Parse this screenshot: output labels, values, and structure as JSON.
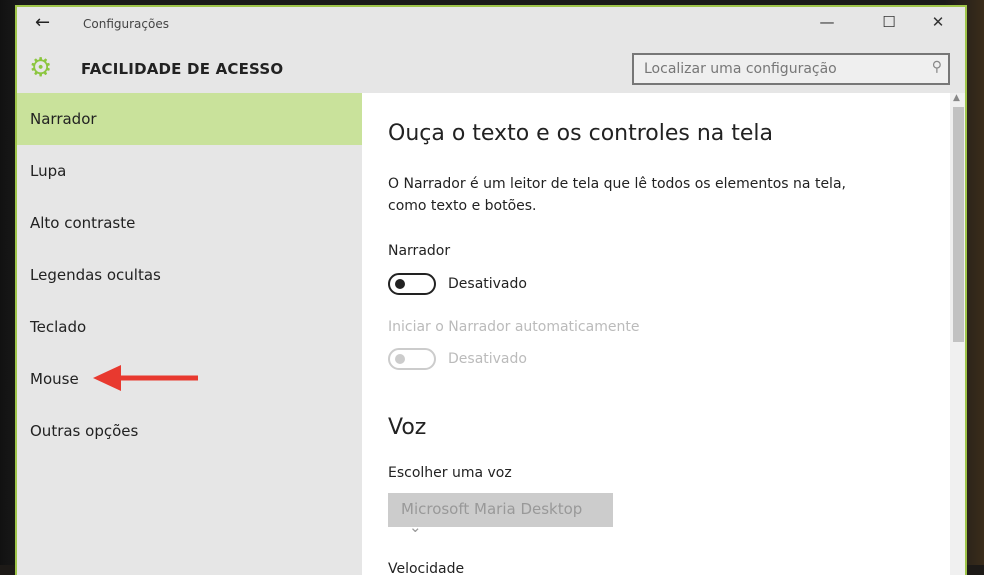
{
  "window": {
    "title": "Configurações",
    "section": "FACILIDADE DE ACESSO",
    "search_placeholder": "Localizar uma configuração"
  },
  "sidebar": {
    "items": [
      {
        "label": "Narrador",
        "selected": true
      },
      {
        "label": "Lupa"
      },
      {
        "label": "Alto contraste"
      },
      {
        "label": "Legendas ocultas"
      },
      {
        "label": "Teclado"
      },
      {
        "label": "Mouse"
      },
      {
        "label": "Outras opções"
      }
    ]
  },
  "main": {
    "heading": "Ouça o texto e os controles na tela",
    "description": "O Narrador é um leitor de tela que lê todos os elementos na tela, como texto e botões.",
    "narrator_label": "Narrador",
    "narrator_state": "Desativado",
    "auto_label": "Iniciar o Narrador automaticamente",
    "auto_state": "Desativado",
    "voice_heading": "Voz",
    "voice_label": "Escolher uma voz",
    "voice_value": "Microsoft Maria Desktop",
    "speed_label": "Velocidade"
  },
  "colors": {
    "accent": "#9fc54a",
    "selected": "#c9e29b",
    "annotation_arrow": "#e8392f"
  }
}
